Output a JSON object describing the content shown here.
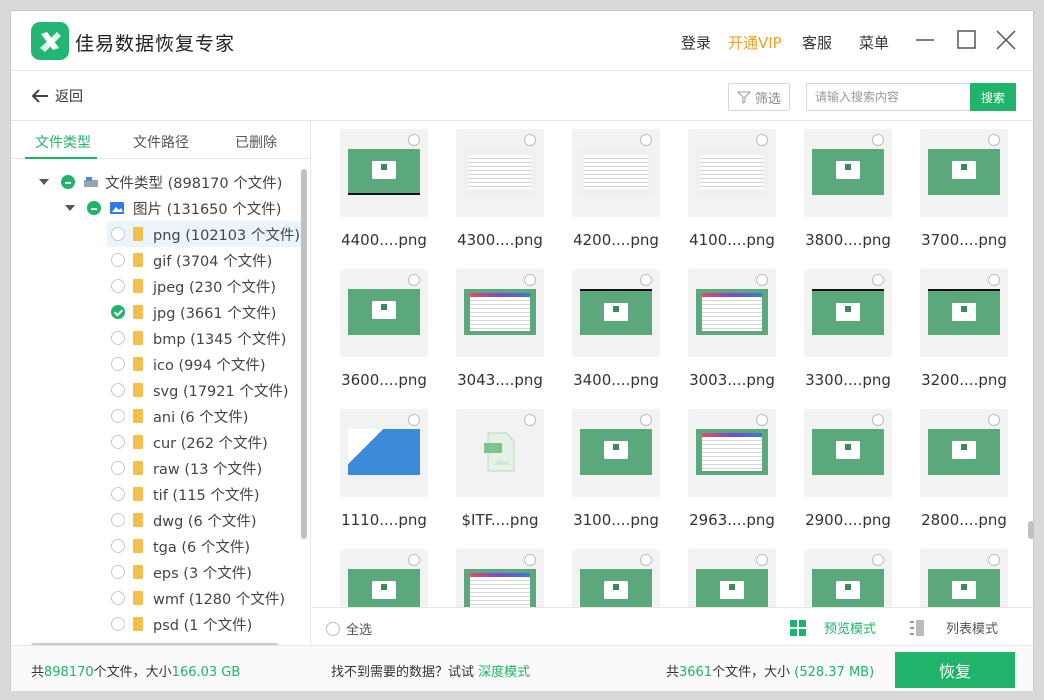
{
  "app": {
    "title": "佳易数据恢复专家",
    "brand_color": "#20b36a",
    "logo_icon": "app-logo-icon"
  },
  "titlebar": {
    "login": "登录",
    "vip": "开通VIP",
    "service": "客服",
    "menu": "菜单",
    "vip_color": "#f0a020"
  },
  "toolbar": {
    "back_label": "返回",
    "filter_label": "筛选",
    "search_placeholder": "请输入搜索内容",
    "search_label": "搜索"
  },
  "left_tabs": [
    {
      "label": "文件类型",
      "active": true
    },
    {
      "label": "文件路径",
      "active": false
    },
    {
      "label": "已删除",
      "active": false
    }
  ],
  "tree": {
    "root": {
      "label": "文件类型 (898170 个文件)"
    },
    "images": {
      "label": "图片 (131650 个文件)"
    },
    "items": [
      {
        "label": "png (102103 个文件)",
        "checked": "none",
        "selected": true
      },
      {
        "label": "gif (3704 个文件)",
        "checked": "none"
      },
      {
        "label": "jpeg (230 个文件)",
        "checked": "none"
      },
      {
        "label": "jpg (3661 个文件)",
        "checked": "full"
      },
      {
        "label": "bmp (1345 个文件)",
        "checked": "none"
      },
      {
        "label": "ico (994 个文件)",
        "checked": "none"
      },
      {
        "label": "svg (17921 个文件)",
        "checked": "none"
      },
      {
        "label": "ani (6 个文件)",
        "checked": "none"
      },
      {
        "label": "cur (262 个文件)",
        "checked": "none"
      },
      {
        "label": "raw (13 个文件)",
        "checked": "none"
      },
      {
        "label": "tif (115 个文件)",
        "checked": "none"
      },
      {
        "label": "dwg (6 个文件)",
        "checked": "none"
      },
      {
        "label": "tga (6 个文件)",
        "checked": "none"
      },
      {
        "label": "eps (3 个文件)",
        "checked": "none"
      },
      {
        "label": "wmf (1280 个文件)",
        "checked": "none"
      },
      {
        "label": "psd (1 个文件)",
        "checked": "none"
      }
    ]
  },
  "files": [
    {
      "name": "4400....png",
      "thumb": "dark"
    },
    {
      "name": "4300....png",
      "thumb": "screen"
    },
    {
      "name": "4200....png",
      "thumb": "screen"
    },
    {
      "name": "4100....png",
      "thumb": "screen"
    },
    {
      "name": "3800....png",
      "thumb": "green"
    },
    {
      "name": "3700....png",
      "thumb": "green"
    },
    {
      "name": "3600....png",
      "thumb": "green"
    },
    {
      "name": "3043....png",
      "thumb": "app"
    },
    {
      "name": "3400....png",
      "thumb": "dark-top"
    },
    {
      "name": "3003....png",
      "thumb": "app"
    },
    {
      "name": "3300....png",
      "thumb": "dark-top"
    },
    {
      "name": "3200....png",
      "thumb": "dark-top"
    },
    {
      "name": "1110....png",
      "thumb": "photo"
    },
    {
      "name": "$ITF....png",
      "thumb": "file"
    },
    {
      "name": "3100....png",
      "thumb": "green"
    },
    {
      "name": "2963....png",
      "thumb": "app"
    },
    {
      "name": "2900....png",
      "thumb": "green"
    },
    {
      "name": "2800....png",
      "thumb": "green"
    },
    {
      "name": "",
      "thumb": "green"
    },
    {
      "name": "",
      "thumb": "app"
    },
    {
      "name": "",
      "thumb": "green"
    },
    {
      "name": "",
      "thumb": "green"
    },
    {
      "name": "",
      "thumb": "green"
    },
    {
      "name": "",
      "thumb": "green"
    }
  ],
  "grid_footer": {
    "select_all": "全选",
    "preview_mode": "预览模式",
    "list_mode": "列表模式"
  },
  "status": {
    "total_prefix": "共",
    "total_count": "898170",
    "total_mid": "个文件，大小",
    "total_size": "166.03 GB",
    "hint": "找不到需要的数据？试试",
    "deep_mode": "深度模式",
    "sel_prefix": "共",
    "sel_count": "3661",
    "sel_mid": "个文件，大小",
    "sel_size": "(528.37 MB)",
    "recover": "恢复"
  }
}
